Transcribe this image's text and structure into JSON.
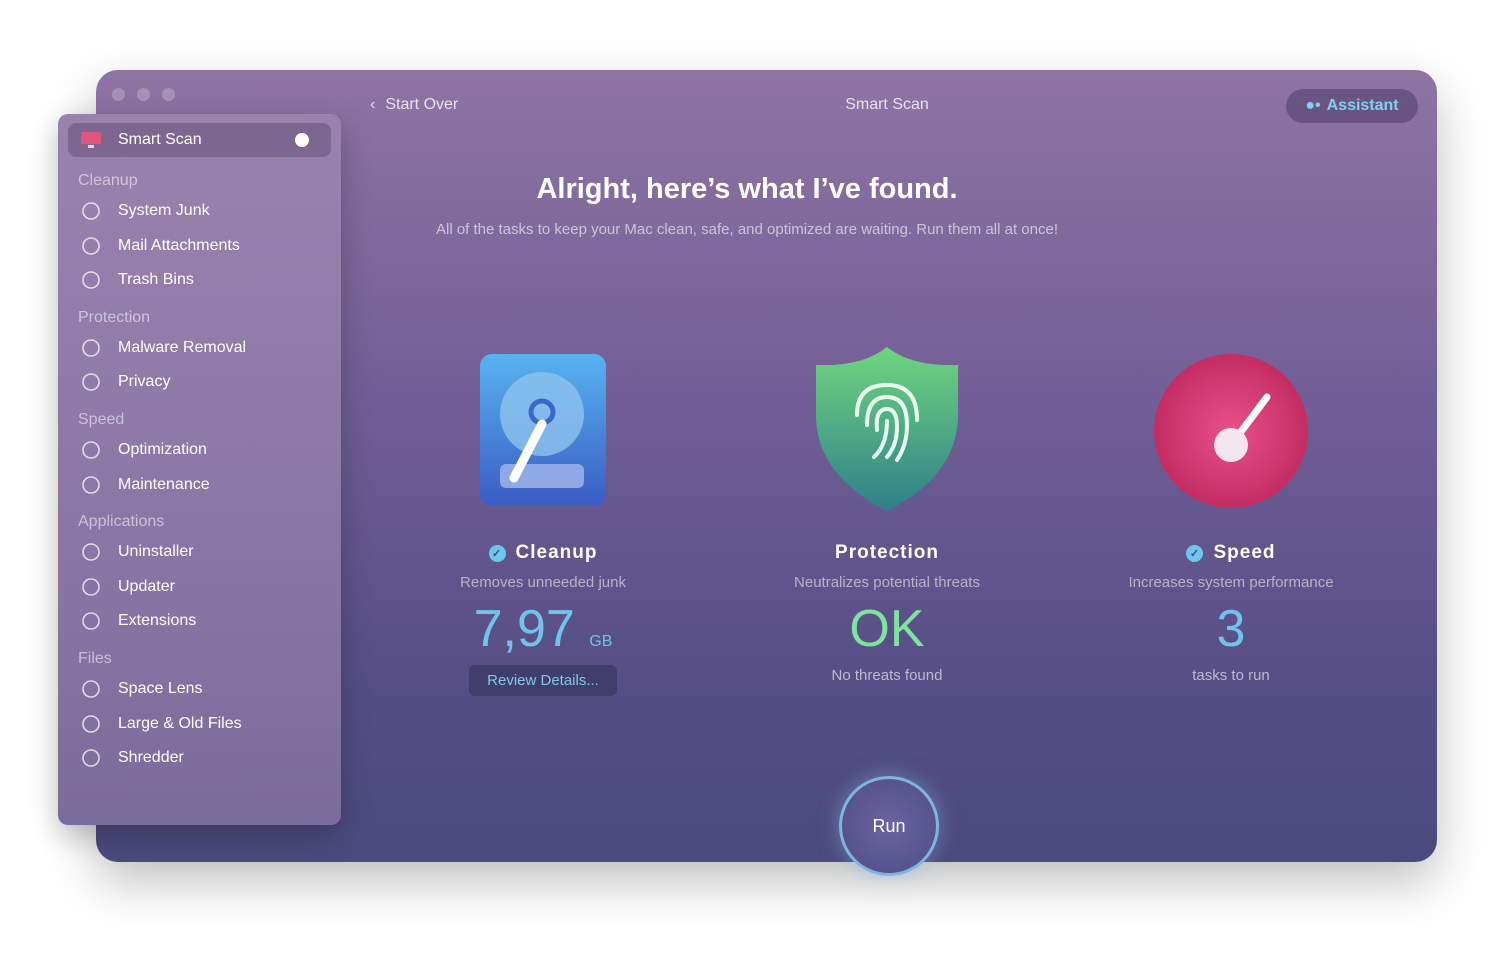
{
  "window": {
    "title": "Smart Scan",
    "back_label": "Start Over",
    "assistant_label": "Assistant"
  },
  "sidebar": {
    "selected": "Smart Scan",
    "sections": [
      {
        "title": "Cleanup",
        "items": [
          "System Junk",
          "Mail Attachments",
          "Trash Bins"
        ]
      },
      {
        "title": "Protection",
        "items": [
          "Malware Removal",
          "Privacy"
        ]
      },
      {
        "title": "Speed",
        "items": [
          "Optimization",
          "Maintenance"
        ]
      },
      {
        "title": "Applications",
        "items": [
          "Uninstaller",
          "Updater",
          "Extensions"
        ]
      },
      {
        "title": "Files",
        "items": [
          "Space Lens",
          "Large & Old Files",
          "Shredder"
        ]
      }
    ]
  },
  "main": {
    "heading": "Alright, here’s what I’ve found.",
    "subheading": "All of the tasks to keep your Mac clean, safe, and optimized are waiting. Run them all at once!",
    "cards": [
      {
        "title": "Cleanup",
        "checked": true,
        "desc": "Removes unneeded junk",
        "value": "7,97",
        "unit": "GB",
        "button": "Review Details...",
        "color": "#72c3ec"
      },
      {
        "title": "Protection",
        "checked": false,
        "desc": "Neutralizes potential threats",
        "value": "OK",
        "footer": "No threats found",
        "color": "#7fe3a0"
      },
      {
        "title": "Speed",
        "checked": true,
        "desc": "Increases system performance",
        "value": "3",
        "footer": "tasks to run",
        "color": "#72c3ec"
      }
    ],
    "run_label": "Run"
  }
}
